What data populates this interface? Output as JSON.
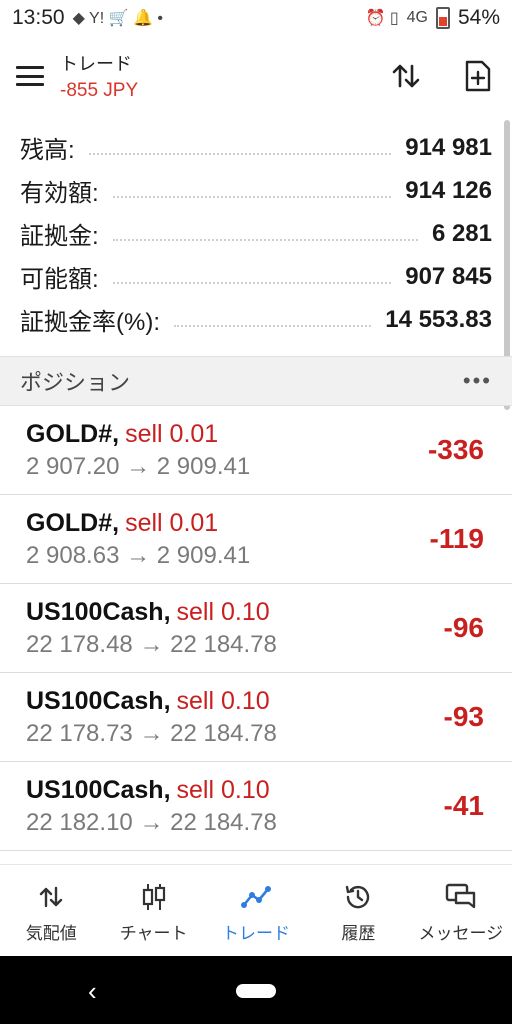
{
  "status_bar": {
    "time": "13:50",
    "network": "4G",
    "battery": "54%"
  },
  "header": {
    "title": "トレード",
    "pnl": "-855 JPY"
  },
  "summary": [
    {
      "label": "残高:",
      "value": "914 981"
    },
    {
      "label": "有効額:",
      "value": "914 126"
    },
    {
      "label": "証拠金:",
      "value": "6 281"
    },
    {
      "label": "可能額:",
      "value": "907 845"
    },
    {
      "label": "証拠金率(%):",
      "value": "14 553.83"
    }
  ],
  "section": {
    "title": "ポジション",
    "more": "•••"
  },
  "positions": [
    {
      "symbol": "GOLD#,",
      "side": "sell 0.01",
      "prices": "2 907.20 → 2 909.41",
      "pl": "-336"
    },
    {
      "symbol": "GOLD#,",
      "side": "sell 0.01",
      "prices": "2 908.63 → 2 909.41",
      "pl": "-119"
    },
    {
      "symbol": "US100Cash,",
      "side": "sell 0.10",
      "prices": "22 178.48 → 22 184.78",
      "pl": "-96"
    },
    {
      "symbol": "US100Cash,",
      "side": "sell 0.10",
      "prices": "22 178.73 → 22 184.78",
      "pl": "-93"
    },
    {
      "symbol": "US100Cash,",
      "side": "sell 0.10",
      "prices": "22 182.10 → 22 184.78",
      "pl": "-41"
    }
  ],
  "nav": [
    {
      "label": "気配値",
      "icon": "quotes-icon"
    },
    {
      "label": "チャート",
      "icon": "chart-icon"
    },
    {
      "label": "トレード",
      "icon": "trade-icon"
    },
    {
      "label": "履歴",
      "icon": "history-icon"
    },
    {
      "label": "メッセージ",
      "icon": "messages-icon"
    }
  ],
  "colors": {
    "negative": "#c91f1f",
    "accent": "#2f7de0"
  }
}
